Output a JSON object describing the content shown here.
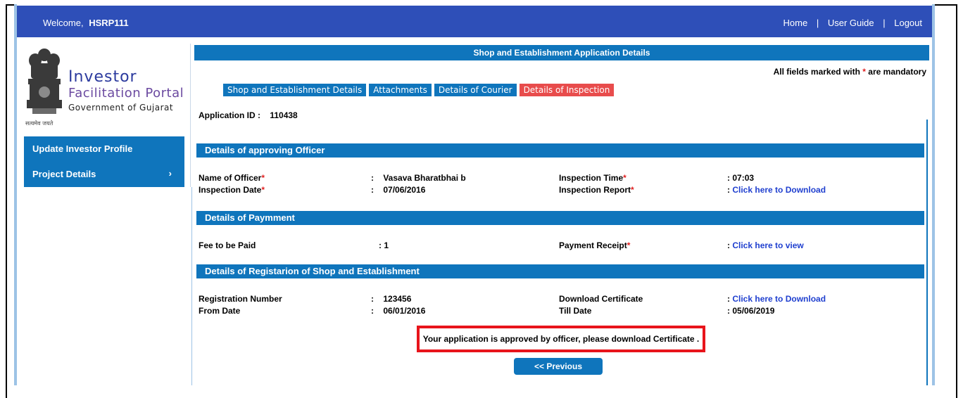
{
  "topbar": {
    "welcome_label": "Welcome,",
    "username": "HSRP111",
    "links": [
      "Home",
      "User Guide",
      "Logout"
    ],
    "separator": "|"
  },
  "logo": {
    "line1": "Investor",
    "line2": "Facilitation Portal",
    "line3": "Government of Gujarat",
    "emblem_caption": "सत्यमेव जयते"
  },
  "sidebar": {
    "items": [
      {
        "label": "Update Investor Profile"
      },
      {
        "label": "Project Details",
        "chevron": "›"
      }
    ]
  },
  "main": {
    "header": "Shop and Establishment Application Details",
    "mandatory_prefix": "All fields marked with",
    "mandatory_star": "*",
    "mandatory_suffix": "are mandatory",
    "tabs": [
      {
        "label": "Shop and Establishment Details",
        "active": false
      },
      {
        "label": "Attachments",
        "active": false
      },
      {
        "label": "Details of Courier",
        "active": false
      },
      {
        "label": "Details of Inspection",
        "active": true
      }
    ],
    "application_id_label": "Application ID  :",
    "application_id": "110438"
  },
  "approving_officer": {
    "title": "Details of approving Officer",
    "name_label": "Name of Officer",
    "name_value": "Vasava Bharatbhai b",
    "date_label": "Inspection Date",
    "date_value": "07/06/2016",
    "time_label": "Inspection Time",
    "time_value": "07:03",
    "report_label": "Inspection Report",
    "report_link": "Click here to Download"
  },
  "payment": {
    "title": "Details of Paymment",
    "fee_label": "Fee to be Paid",
    "fee_value": "1",
    "receipt_label": "Payment Receipt",
    "receipt_link": "Click here to view"
  },
  "registration": {
    "title": "Details of Registarion of Shop and Establishment",
    "number_label": "Registration Number",
    "number_value": "123456",
    "from_label": "From Date",
    "from_value": "06/01/2016",
    "certificate_label": "Download Certificate",
    "certificate_link": "Click here to Download",
    "till_label": "Till Date",
    "till_value": "05/06/2019"
  },
  "notice": "Your application is approved by officer, please download Certificate .",
  "previous_button": "<< Previous",
  "colors": {
    "topbar": "#2e4fb8",
    "primary": "#0f75bc",
    "active_tab": "#e84c4c",
    "required_star": "#e02020",
    "link": "#1f3fcf",
    "notice_border": "#e8141b"
  }
}
